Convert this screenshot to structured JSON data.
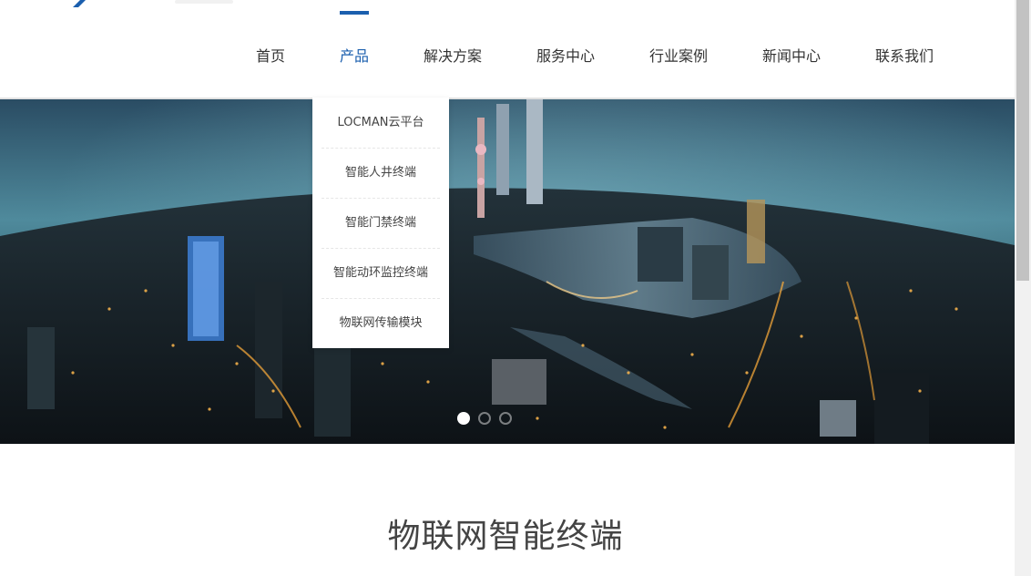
{
  "header": {
    "nav": [
      {
        "label": "首页"
      },
      {
        "label": "产品"
      },
      {
        "label": "解决方案"
      },
      {
        "label": "服务中心"
      },
      {
        "label": "行业案例"
      },
      {
        "label": "新闻中心"
      },
      {
        "label": "联系我们"
      }
    ],
    "active_nav": "产品"
  },
  "dropdown": {
    "items": [
      {
        "label": "LOCMAN云平台"
      },
      {
        "label": "智能人井终端"
      },
      {
        "label": "智能门禁终端"
      },
      {
        "label": "智能动环监控终端"
      },
      {
        "label": "物联网传输模块"
      }
    ]
  },
  "banner": {
    "active_slide": 1,
    "total_slides": 3
  },
  "section": {
    "title": "物联网智能终端"
  },
  "colors": {
    "accent": "#1b5fae",
    "text": "#333333"
  }
}
